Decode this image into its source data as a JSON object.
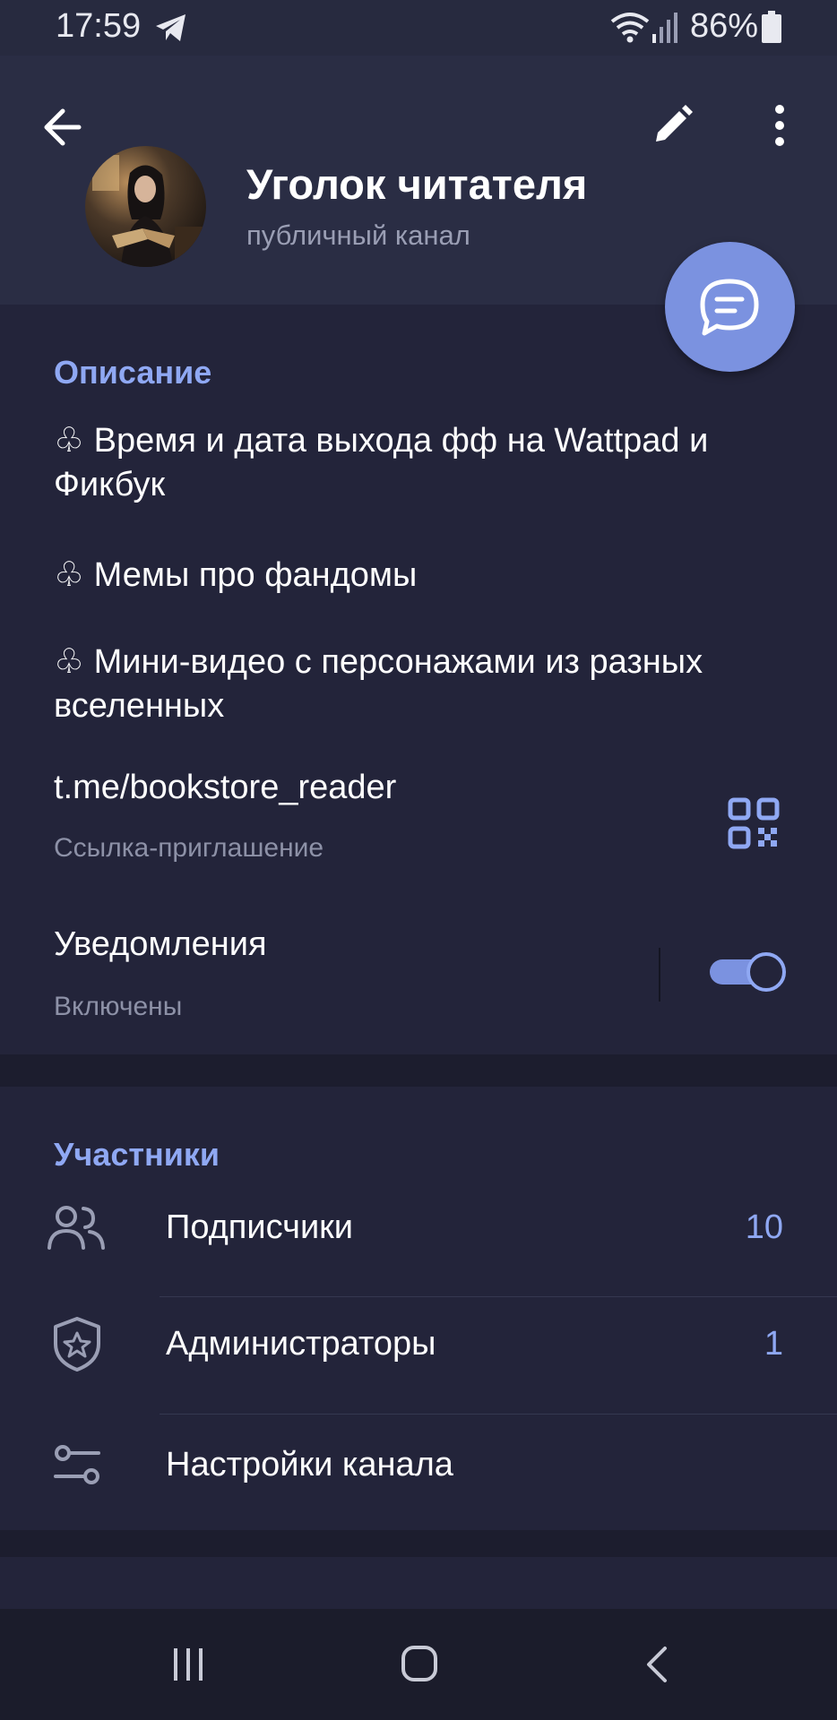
{
  "status": {
    "time": "17:59",
    "battery": "86%"
  },
  "channel": {
    "title": "Уголок читателя",
    "subtitle": "публичный канал"
  },
  "description": {
    "title": "Описание",
    "lines": [
      "♧ Время и дата выхода фф на Wattpad и Фикбук",
      "♧ Мемы про фандомы",
      "♧ Мини-видео с персонажами из разных вселенных"
    ]
  },
  "link": {
    "url": "t.me/bookstore_reader",
    "caption": "Ссылка-приглашение"
  },
  "notifications": {
    "label": "Уведомления",
    "state": "Включены",
    "enabled": true
  },
  "members": {
    "title": "Участники",
    "items": [
      {
        "label": "Подписчики",
        "count": "10",
        "icon": "people-icon"
      },
      {
        "label": "Администраторы",
        "count": "1",
        "icon": "shield-star-icon"
      },
      {
        "label": "Настройки канала",
        "count": "",
        "icon": "settings-sliders-icon"
      }
    ]
  },
  "colors": {
    "accent": "#8fa8f3",
    "fab": "#7b92e0",
    "background": "#23243a",
    "header": "#2a2d44"
  }
}
